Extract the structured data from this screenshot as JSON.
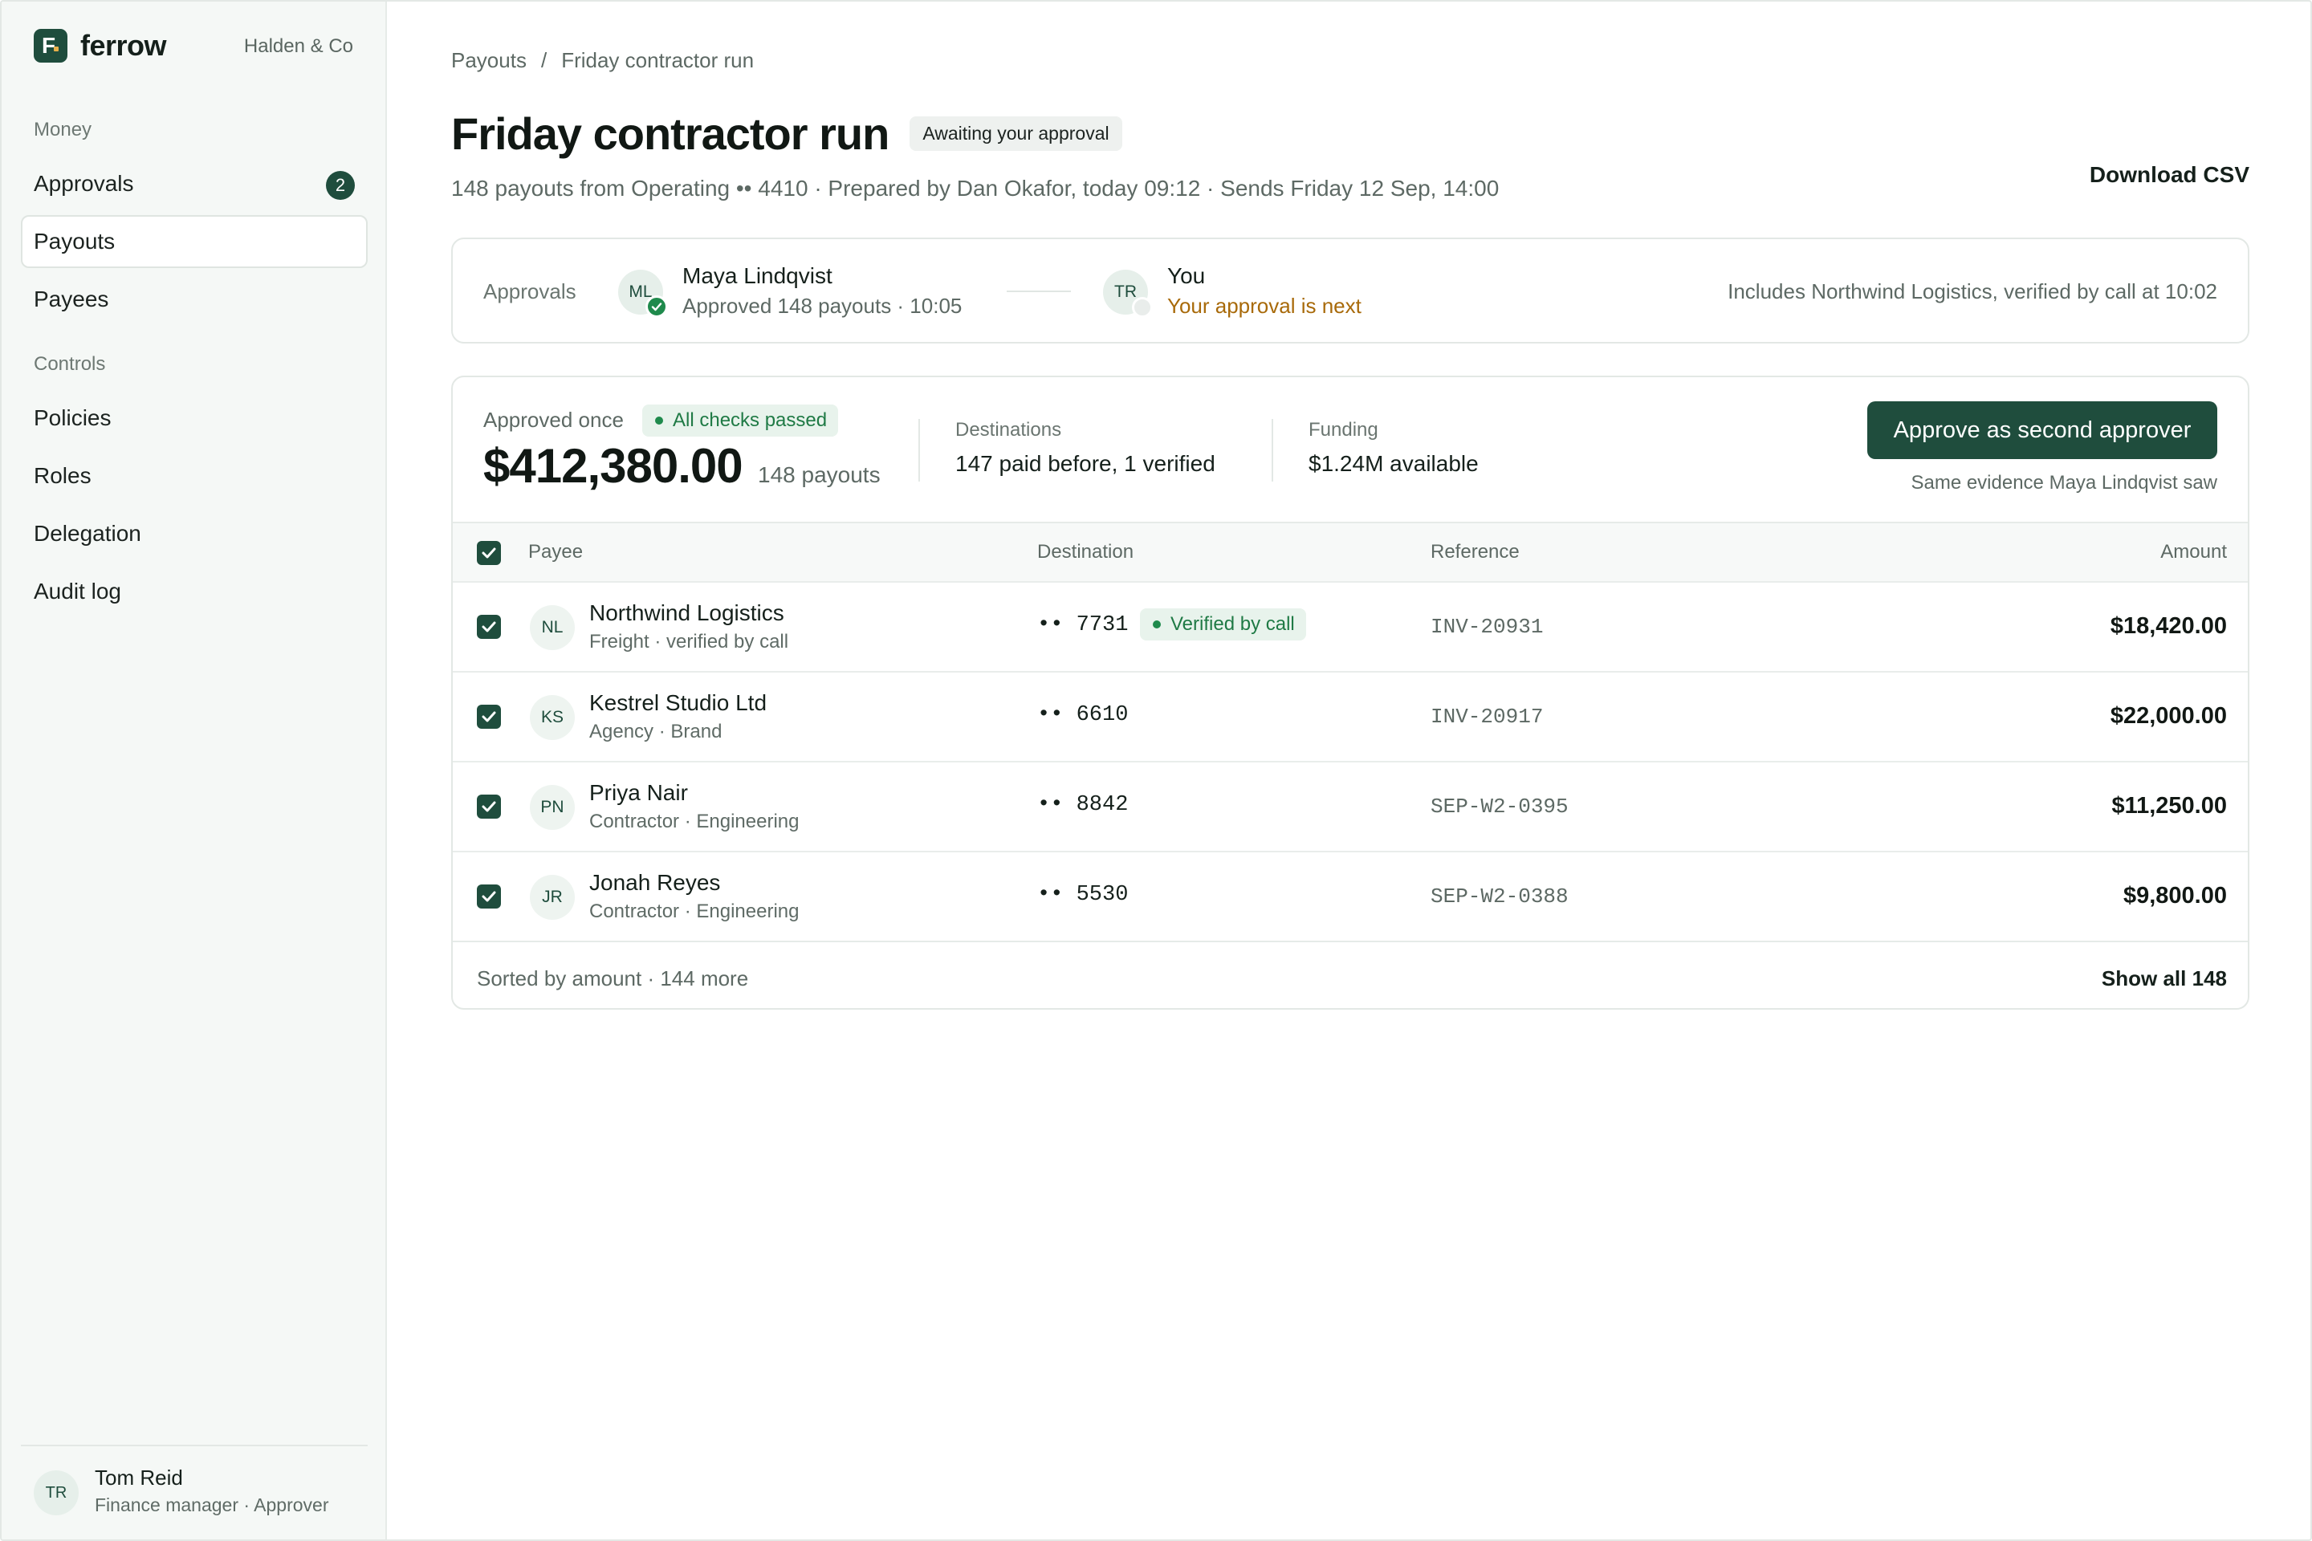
{
  "brand": {
    "name": "ferrow",
    "org": "Halden & Co"
  },
  "sidebar": {
    "sections": [
      {
        "label": "Money"
      },
      {
        "label": "Controls"
      }
    ],
    "items": [
      {
        "label": "Approvals",
        "badge": "2"
      },
      {
        "label": "Payouts",
        "active": true
      },
      {
        "label": "Payees"
      },
      {
        "label": "Policies"
      },
      {
        "label": "Roles"
      },
      {
        "label": "Delegation"
      },
      {
        "label": "Audit log"
      }
    ],
    "user": {
      "initials": "TR",
      "name": "Tom Reid",
      "role": "Finance manager · Approver"
    }
  },
  "breadcrumb": {
    "root": "Payouts",
    "separator": "/",
    "current": "Friday contractor run"
  },
  "header": {
    "title": "Friday contractor run",
    "status": "Awaiting your approval",
    "subtitle": "148 payouts from Operating •• 4410 · Prepared by Dan Okafor, today 09:12 · Sends Friday 12 Sep, 14:00",
    "download_label": "Download CSV"
  },
  "approvals": {
    "label": "Approvals",
    "first": {
      "initials": "ML",
      "name": "Maya Lindqvist",
      "meta": "Approved 148 payouts · 10:05"
    },
    "second": {
      "initials": "TR",
      "name": "You",
      "meta": "Your approval is next"
    },
    "note": "Includes Northwind Logistics, verified by call at 10:02"
  },
  "summary": {
    "label": "Approved once",
    "checks": "All checks passed",
    "amount": "$412,380.00",
    "count": "148 payouts",
    "destinations_label": "Destinations",
    "destinations_value": "147 paid before, 1 verified",
    "funding_label": "Funding",
    "funding_value": "$1.24M available",
    "approve_label": "Approve as second approver",
    "approve_note": "Same evidence Maya Lindqvist saw"
  },
  "table": {
    "headers": {
      "payee": "Payee",
      "destination": "Destination",
      "reference": "Reference",
      "amount": "Amount"
    },
    "rows": [
      {
        "initials": "NL",
        "name": "Northwind Logistics",
        "sub": "Freight · verified by call",
        "dest": "•• 7731",
        "badge": "Verified by call",
        "ref": "INV-20931",
        "amount": "$18,420.00"
      },
      {
        "initials": "KS",
        "name": "Kestrel Studio Ltd",
        "sub": "Agency · Brand",
        "dest": "•• 6610",
        "ref": "INV-20917",
        "amount": "$22,000.00"
      },
      {
        "initials": "PN",
        "name": "Priya Nair",
        "sub": "Contractor · Engineering",
        "dest": "•• 8842",
        "ref": "SEP-W2-0395",
        "amount": "$11,250.00"
      },
      {
        "initials": "JR",
        "name": "Jonah Reyes",
        "sub": "Contractor · Engineering",
        "dest": "•• 5530",
        "ref": "SEP-W2-0388",
        "amount": "$9,800.00"
      }
    ],
    "footer": {
      "left": "Sorted by amount · 144 more",
      "right": "Show all 148"
    }
  },
  "colors": {
    "accent": "#1f4d3d",
    "success": "#1f8a4c",
    "warning": "#a86a0a"
  },
  "icons": {
    "logo": "ferrow-logo-icon",
    "check": "check-icon"
  }
}
